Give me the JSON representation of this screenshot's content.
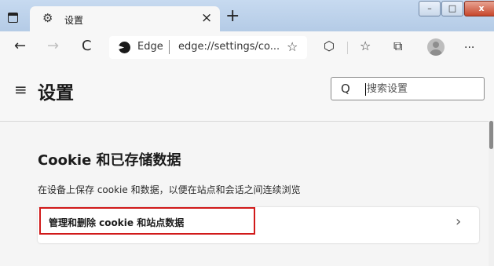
{
  "window": {
    "tab_title": "设置",
    "tab_icon": "gear-icon",
    "tab_close": "×",
    "new_tab": "+",
    "minimize": "–",
    "maximize": "□",
    "close": "x"
  },
  "toolbar": {
    "back": "←",
    "forward": "→",
    "refresh": "C",
    "address": {
      "brand": "Edge",
      "url": "edge://settings/co..."
    },
    "more": "···"
  },
  "settings": {
    "title": "设置",
    "hamburger": "≡",
    "search": {
      "icon": "Q",
      "placeholder": "搜索设置"
    }
  },
  "section": {
    "title": "Cookie 和已存储数据",
    "description": "在设备上保存 cookie 和数据，以便在站点和会话之间连续浏览",
    "card": {
      "label": "管理和删除 cookie 和站点数据",
      "chevron": "›",
      "highlight_color": "#d11a1a"
    }
  }
}
